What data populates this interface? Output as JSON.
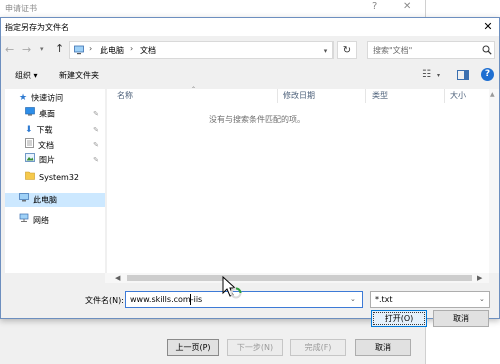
{
  "background_window": {
    "title": "申请证书",
    "help_glyph": "?",
    "close_glyph": "✕",
    "buttons": {
      "prev": "上一页(P)",
      "next": "下一步(N)",
      "finish": "完成(F)",
      "cancel": "取消"
    }
  },
  "dialog": {
    "title": "指定另存为文件名",
    "close_glyph": "✕",
    "nav": {
      "back_glyph": "←",
      "forward_glyph": "→",
      "dropdown_glyph": "▾",
      "up_glyph": "↑"
    },
    "address": {
      "separator": "›",
      "crumbs": [
        "此电脑",
        "文档"
      ]
    },
    "refresh_glyph": "↻",
    "search": {
      "placeholder": "搜索\"文档\""
    },
    "toolbar": {
      "organize": "组织 ▾",
      "new_folder": "新建文件夹",
      "help": "?"
    },
    "nav_pane": {
      "quick_access": "快速访问",
      "items": [
        "桌面",
        "下载",
        "文档",
        "图片",
        "System32"
      ],
      "this_pc": "此电脑",
      "network": "网络"
    },
    "file_list": {
      "columns": [
        "名称",
        "修改日期",
        "类型",
        "大小"
      ],
      "empty_message": "没有与搜索条件匹配的项。"
    },
    "filename": {
      "label": "文件名(N):",
      "value": "www.skills.com-iis"
    },
    "file_type": {
      "value": "*.txt"
    },
    "buttons": {
      "open": "打开(O)",
      "cancel": "取消"
    }
  },
  "colors": {
    "accent": "#0078d7",
    "folder": "#f6c94c",
    "pc_selected": "#cce8ff"
  }
}
